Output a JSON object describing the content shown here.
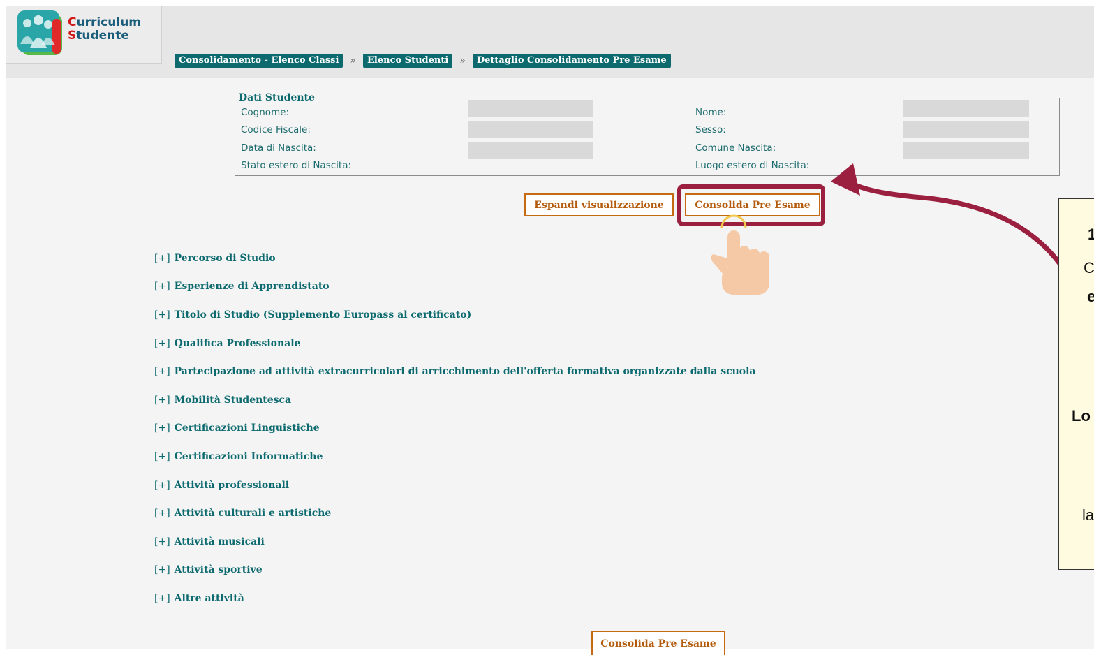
{
  "app": {
    "title_line1": "Curriculum",
    "title_line2": "Studente",
    "title_initial1": "C",
    "title_rest1": "urriculum",
    "title_initial2": "S",
    "title_rest2": "tudente"
  },
  "breadcrumb": {
    "items": [
      "Consolidamento - Elenco Classi",
      "Elenco Studenti",
      "Dettaglio Consolidamento Pre Esame"
    ],
    "separator": "»"
  },
  "student_data": {
    "legend": "Dati Studente",
    "fields": {
      "cognome": "Cognome:",
      "codice_fiscale": "Codice Fiscale:",
      "data_nascita": "Data di Nascita:",
      "stato_estero": "Stato estero di Nascita:",
      "nome": "Nome:",
      "sesso": "Sesso:",
      "comune_nascita": "Comune Nascita:",
      "luogo_estero": "Luogo estero di Nascita:"
    }
  },
  "actions": {
    "expand_label": "Espandi visualizzazione",
    "consolidate_label": "Consolida Pre Esame"
  },
  "sections": {
    "toggle": "[+]",
    "items": [
      "Percorso di Studio",
      "Esperienze di Apprendistato",
      "Titolo di Studio (Supplemento Europass al certificato)",
      "Qualifica Professionale",
      "Partecipazione ad attività extracurricolari di arricchimento dell'offerta formativa organizzate dalla scuola",
      "Mobilità Studentesca",
      "Certificazioni Linguistiche",
      "Certificazioni Informatiche",
      "Attività professionali",
      "Attività culturali e artistiche",
      "Attività musicali",
      "Attività sportive",
      "Altre attività"
    ]
  },
  "callout": {
    "lines": [
      "1",
      "C",
      "e",
      "Lo",
      "la"
    ]
  },
  "colors": {
    "accent": "#0c6a6f",
    "button_text": "#b35b0c",
    "button_border": "#c36a12",
    "highlight": "#9b1f3f",
    "callout_bg": "#fffbe0"
  }
}
